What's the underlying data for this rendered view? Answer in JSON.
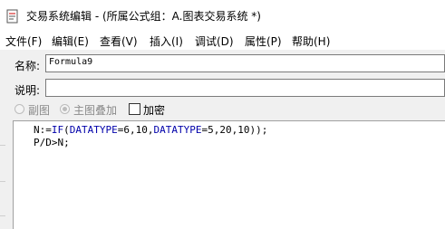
{
  "window": {
    "title": "交易系统编辑 - (所属公式组：A.图表交易系统 *)"
  },
  "menu": {
    "items": [
      {
        "label": "文件(F)"
      },
      {
        "label": "编辑(E)"
      },
      {
        "label": "查看(V)"
      },
      {
        "label": "插入(I)"
      },
      {
        "label": "调试(D)"
      },
      {
        "label": "属性(P)"
      },
      {
        "label": "帮助(H)"
      }
    ]
  },
  "form": {
    "name_label": "名称:",
    "name_value": "Formula9",
    "desc_label": "说明:",
    "desc_value": "",
    "radio_sub_chart": "副图",
    "radio_main_overlay": "主图叠加",
    "checkbox_encrypt": "加密"
  },
  "editor": {
    "line1": {
      "p1": "N:=",
      "p2": "IF",
      "p3": "(",
      "p4": "DATATYPE",
      "p5": "=6,10,",
      "p6": "DATATYPE",
      "p7": "=5,20,10));"
    },
    "line2": "P/D>N;"
  }
}
